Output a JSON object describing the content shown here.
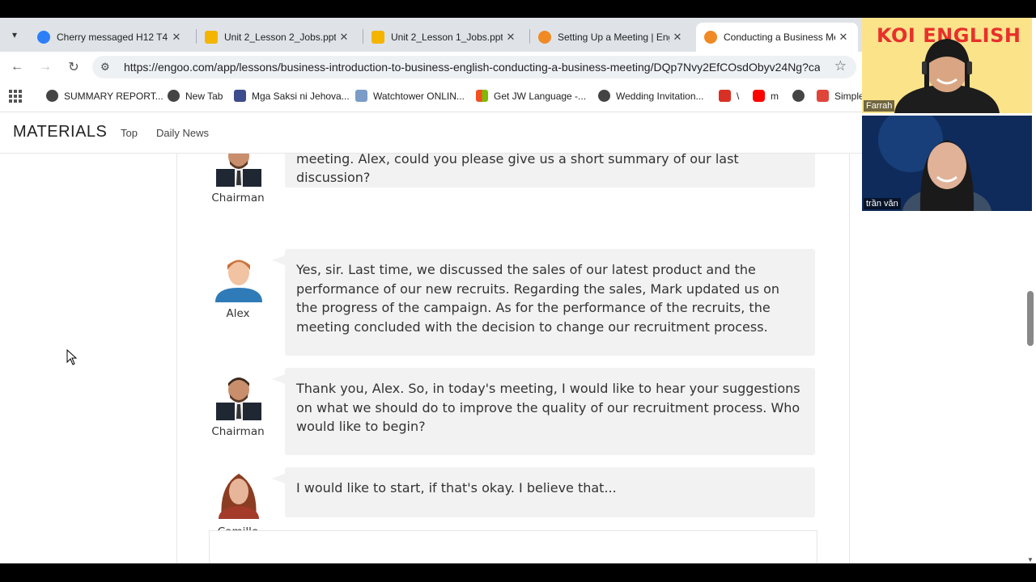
{
  "browser": {
    "tabs": [
      {
        "title": "Cherry messaged H12 T4 (",
        "favicon": "messenger-icon",
        "color": "#2d7ff9"
      },
      {
        "title": "Unit 2_Lesson 2_Jobs.pptx",
        "favicon": "slides-icon",
        "color": "#f4b400"
      },
      {
        "title": "Unit 2_Lesson 1_Jobs.pptx",
        "favicon": "slides-icon",
        "color": "#f4b400"
      },
      {
        "title": "Setting Up a Meeting | Eng",
        "favicon": "engoo-icon",
        "color": "#f08a24"
      },
      {
        "title": "Conducting a Business Me",
        "favicon": "engoo-icon",
        "color": "#f08a24",
        "active": true
      }
    ],
    "url": "https://engoo.com/app/lessons/business-introduction-to-business-english-conducting-a-business-meeting/DQp7Nvy2EfCOsdObyv24Ng?cat...",
    "bookmarks": [
      {
        "label": "SUMMARY REPORT...",
        "icon": "globe-icon"
      },
      {
        "label": "New Tab",
        "icon": "globe-icon"
      },
      {
        "label": "Mga Saksi ni Jehova...",
        "icon": "jw-icon"
      },
      {
        "label": "Watchtower ONLIN...",
        "icon": "watchtower-icon"
      },
      {
        "label": "Get JW Language -...",
        "icon": "microsoft-icon"
      },
      {
        "label": "Wedding Invitation...",
        "icon": "globe-icon"
      },
      {
        "label": "\\",
        "icon": "red-app-icon"
      },
      {
        "label": "m",
        "icon": "youtube-icon"
      },
      {
        "label": "",
        "icon": "globe-icon"
      },
      {
        "label": "Simple",
        "icon": "simple-icon"
      }
    ]
  },
  "site": {
    "brand": "MATERIALS",
    "nav": [
      "Top",
      "Daily News"
    ]
  },
  "dialogue": [
    {
      "speaker": "Chairman",
      "text": "All right. Before we begin, let's quickly go over the main points of our last meeting. Alex, could you please give us a short summary of our last discussion?"
    },
    {
      "speaker": "Alex",
      "text": "Yes, sir. Last time, we discussed the sales of our latest product and the performance of our new recruits. Regarding the sales, Mark updated us on the progress of the campaign. As for the performance of the recruits, the meeting concluded with the decision to change our recruitment process."
    },
    {
      "speaker": "Chairman",
      "text": "Thank you, Alex. So, in today's meeting, I would like to hear your suggestions on what we should do to improve the quality of our recruitment process. Who would like to begin?"
    },
    {
      "speaker": "Camille",
      "text": "I would like to start, if that's okay. I believe that..."
    }
  ],
  "video": {
    "participants": [
      {
        "name": "Farrah",
        "overlay": "KOI ENGLISH"
      },
      {
        "name": "trần văn"
      }
    ]
  },
  "colors": {
    "accent_orange": "#f08a24",
    "koi_red": "#e8302b",
    "bubble": "#f2f2f2"
  }
}
